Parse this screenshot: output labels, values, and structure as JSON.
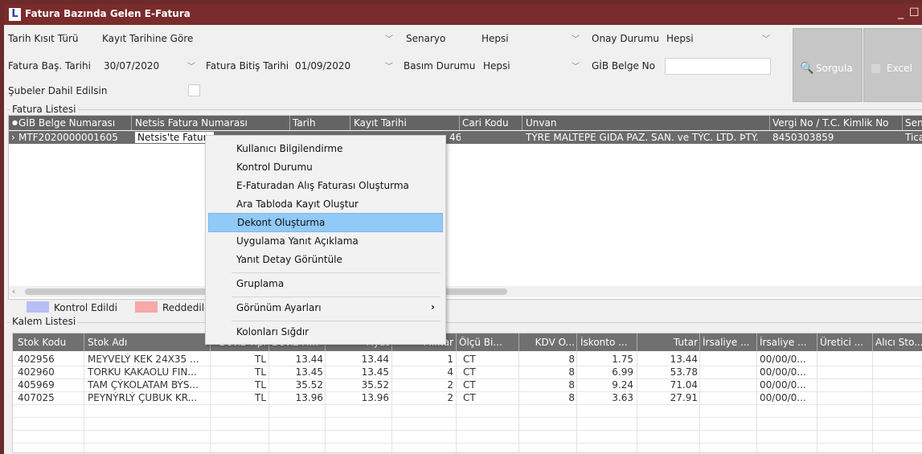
{
  "window": {
    "title": "Fatura Bazında Gelen E-Fatura",
    "logo": "L",
    "controls": {
      "minimize": "_",
      "maximize": "☐"
    }
  },
  "filters": {
    "tarih_kisit_turu": {
      "label": "Tarih Kısıt Türü",
      "value": "Kayıt Tarihine Göre"
    },
    "senaryo": {
      "label": "Senaryo",
      "value": "Hepsi"
    },
    "onay_durumu": {
      "label": "Onay Durumu",
      "value": "Hepsi"
    },
    "fatura_bas_tarihi": {
      "label": "Fatura Baş. Tarihi",
      "value": "30/07/2020"
    },
    "fatura_bitis_tarihi": {
      "label": "Fatura Bitiş Tarihi",
      "value": "01/09/2020"
    },
    "basim_durumu": {
      "label": "Basım Durumu",
      "value": "Hepsi"
    },
    "gib_belge_no": {
      "label": "GİB Belge No",
      "value": ""
    },
    "subeler_dahil": {
      "label": "Şubeler Dahil Edilsin"
    }
  },
  "buttons": {
    "sorgula": "Sorgula",
    "excel": "Excel"
  },
  "fatura_listesi": {
    "title": "Fatura Listesi",
    "columns": [
      "GİB Belge Numarası",
      "Netsis Fatura Numarası",
      "Tarih",
      "Kayıt Tarihi",
      "Cari Kodu",
      "Unvan",
      "Vergi No / T.C. Kimlik No",
      "Sena"
    ],
    "rows": [
      {
        "gib": "MTF2020000001605",
        "netsis": "Netsis'te Fatura",
        "kayit": "46",
        "unvan": "TÝRE MALTEPE GIDA PAZ. SAN. ve TÝC. LTD. ÞTÝ.",
        "vergi": "8450303859",
        "sena": "Ticar"
      }
    ]
  },
  "legend": {
    "kontrol_edildi": "Kontrol Edildi",
    "reddedildi": "Reddedild",
    "colors": {
      "kontrol": "#b8bff5",
      "red": "#f5a9a9"
    }
  },
  "kalem_listesi": {
    "title": "Kalem Listesi",
    "columns": [
      "Stok Kodu",
      "Stok Adı",
      "Döviz Tipi",
      "Döviz Fi...",
      "Fiyat",
      "Miktar",
      "Ölçü Bi...",
      "KDV O...",
      "İskonto ...",
      "Tutar",
      "İrsaliye ...",
      "İrsaliye ...",
      "Üretici ...",
      "Alıcı Sto..."
    ],
    "rows": [
      {
        "kod": "402956",
        "ad": "MEYVELÝ KEK 24X35 ...",
        "doviz": "TL",
        "dfiyat": "13.44",
        "fiyat": "13.44",
        "miktar": "1",
        "olcu": "CT",
        "kdv": "8",
        "iskonto": "1.75",
        "tutar": "13.44",
        "irs": "00/00/0..."
      },
      {
        "kod": "402960",
        "ad": "TORKU KAKAOLU FIN...",
        "doviz": "TL",
        "dfiyat": "13.45",
        "fiyat": "13.45",
        "miktar": "4",
        "olcu": "CT",
        "kdv": "8",
        "iskonto": "6.99",
        "tutar": "53.78",
        "irs": "00/00/0..."
      },
      {
        "kod": "405969",
        "ad": "TAM ÇÝKOLATAM BÝS...",
        "doviz": "TL",
        "dfiyat": "35.52",
        "fiyat": "35.52",
        "miktar": "2",
        "olcu": "CT",
        "kdv": "8",
        "iskonto": "9.24",
        "tutar": "71.04",
        "irs": "00/00/0..."
      },
      {
        "kod": "407025",
        "ad": "PEYNÝRLÝ ÇUBUK KR...",
        "doviz": "TL",
        "dfiyat": "13.96",
        "fiyat": "13.96",
        "miktar": "2",
        "olcu": "CT",
        "kdv": "8",
        "iskonto": "3.63",
        "tutar": "27.91",
        "irs": "00/00/0..."
      }
    ]
  },
  "context_menu": {
    "items": [
      "Kullanıcı Bilgilendirme",
      "Kontrol Durumu",
      "E-Faturadan Alış Faturası Oluşturma",
      "Ara Tabloda Kayıt Oluştur",
      "Dekont Oluşturma",
      "Uygulama Yanıt Açıklama",
      "Yanıt Detay Görüntüle",
      "Gruplama",
      "Görünüm Ayarları",
      "Kolonları Sığdır"
    ],
    "highlighted": "Dekont Oluşturma",
    "submenu_arrow": "›"
  }
}
